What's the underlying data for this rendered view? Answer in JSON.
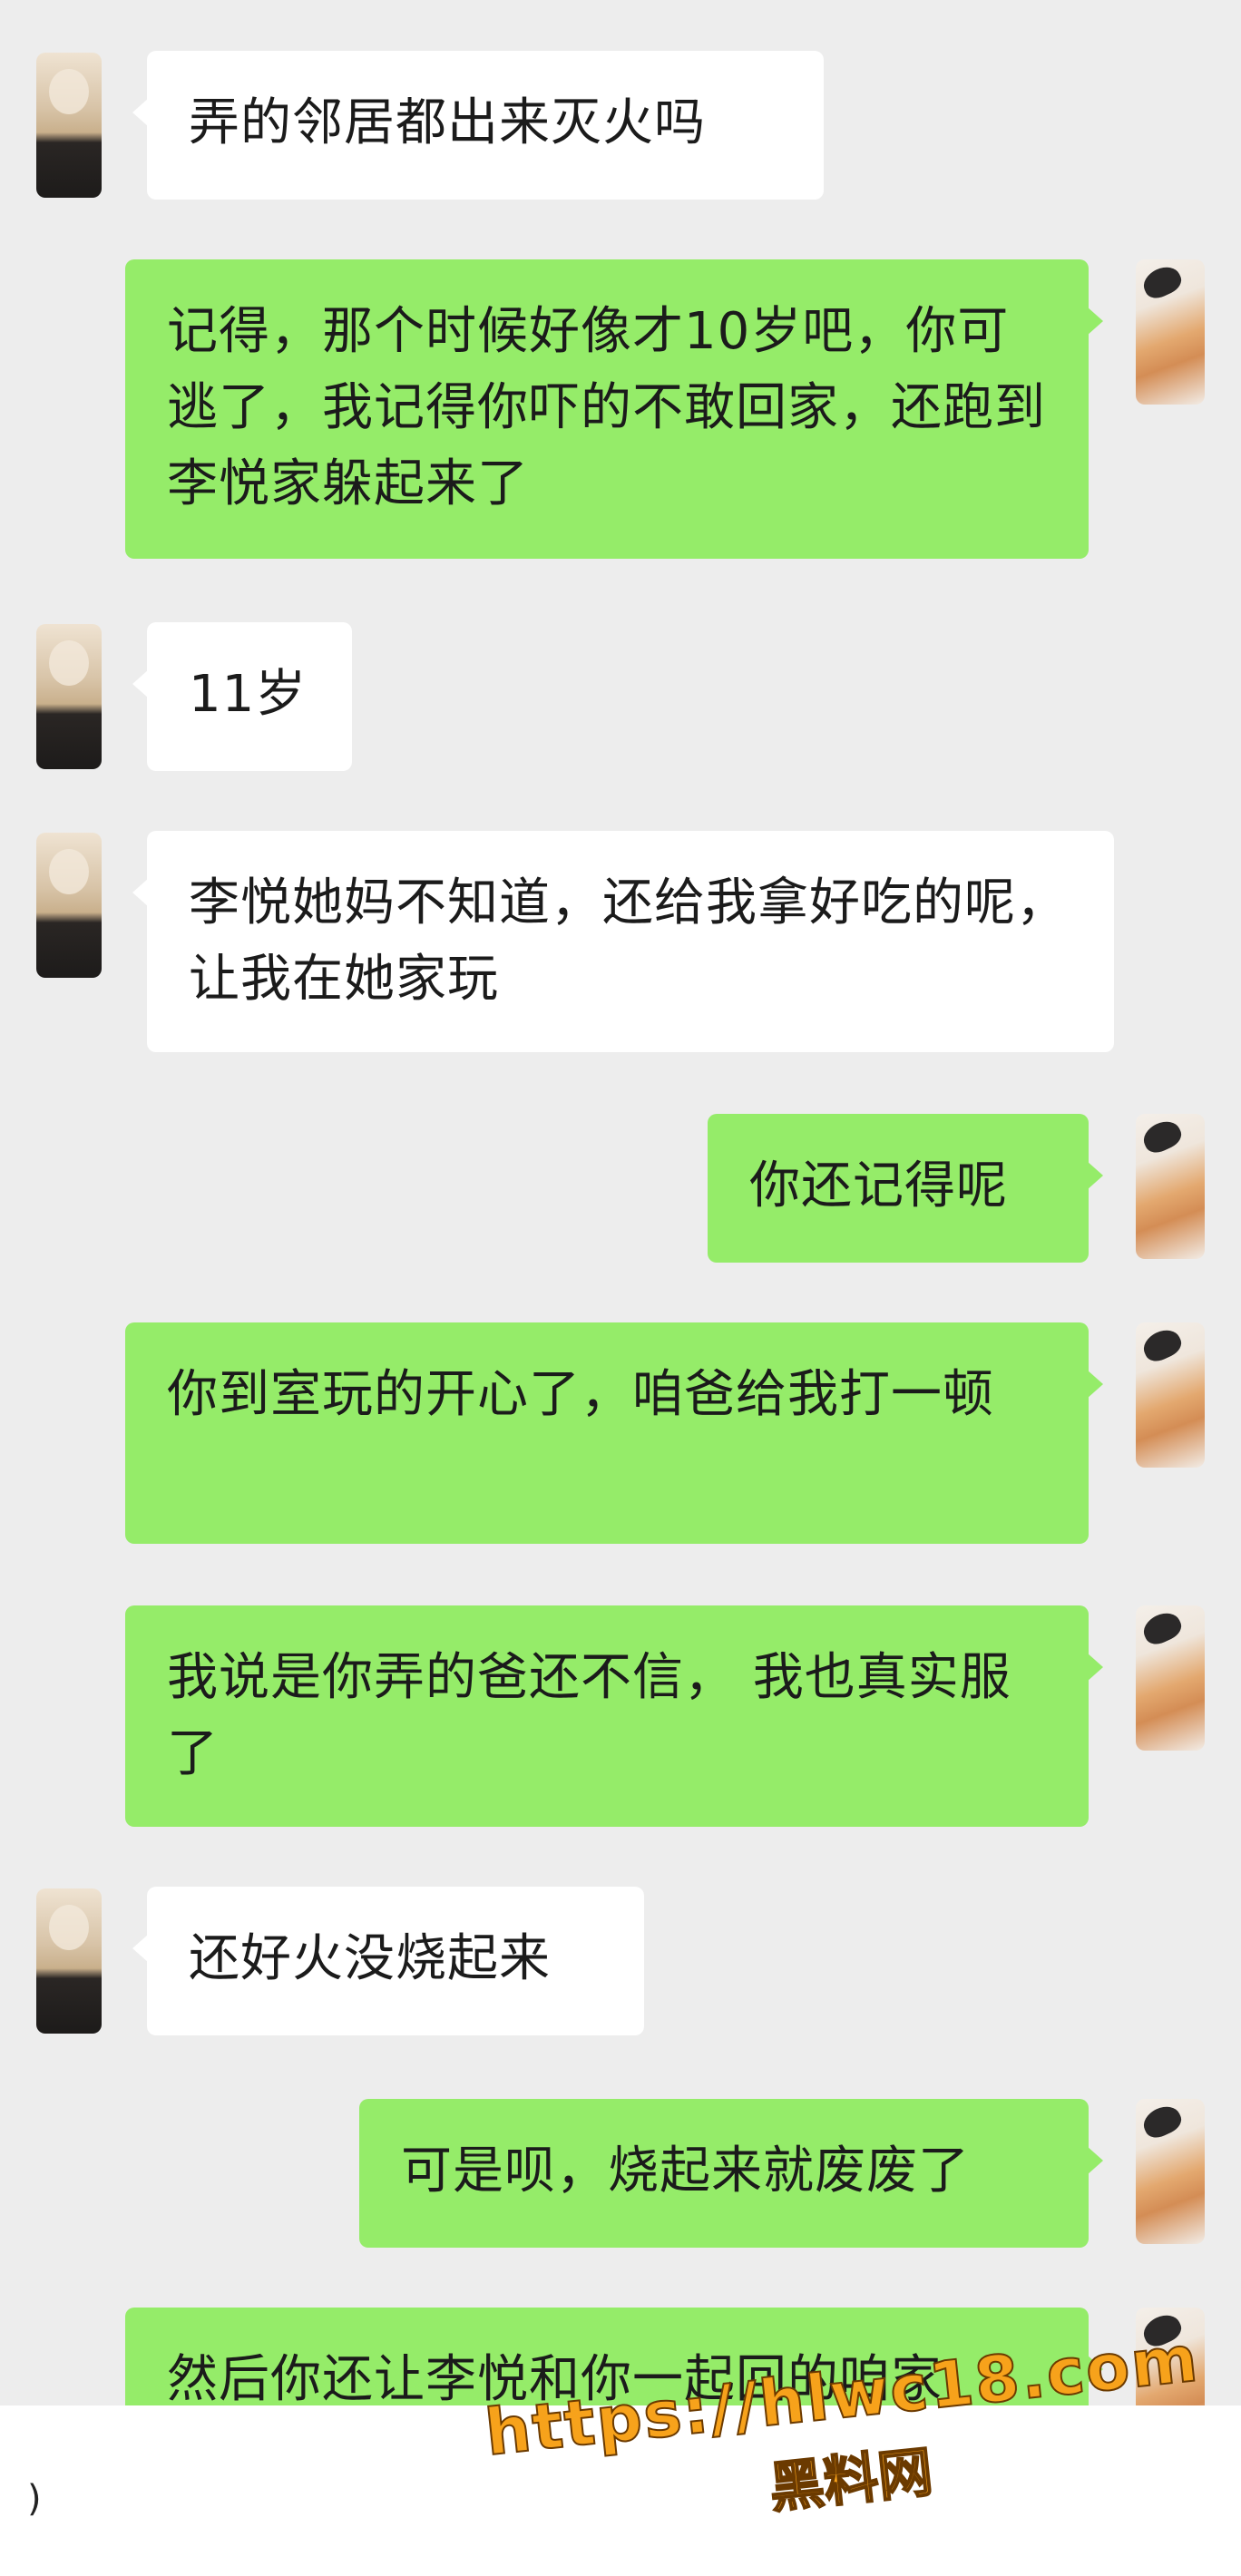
{
  "messages": [
    {
      "side": "in",
      "text": "弄的邻居都出来灭火吗"
    },
    {
      "side": "out",
      "text": "记得，那个时候好像才10岁吧，你可逃了，我记得你吓的不敢回家，还跑到李悦家躲起来了"
    },
    {
      "side": "in",
      "text": "11岁"
    },
    {
      "side": "in",
      "text": "李悦她妈不知道，还给我拿好吃的呢，让我在她家玩"
    },
    {
      "side": "out",
      "text": "你还记得呢"
    },
    {
      "side": "out",
      "text": "你到室玩的开心了，咱爸给我打一顿"
    },
    {
      "side": "out",
      "text": "我说是你弄的爸还不信， 我也真实服了"
    },
    {
      "side": "in",
      "text": "还好火没烧起来"
    },
    {
      "side": "out",
      "text": "可是呗，烧起来就废废了"
    },
    {
      "side": "out",
      "text": "然后你还让李悦和你一起回的咱家"
    }
  ],
  "input_bar": {
    "edge_glyph": ")"
  },
  "watermark": {
    "url": "https://hlwc18.com",
    "brand": "黑料网"
  },
  "colors": {
    "background": "#ededed",
    "incoming_bubble": "#ffffff",
    "outgoing_bubble": "#95ec69",
    "watermark": "#f7a21b"
  }
}
